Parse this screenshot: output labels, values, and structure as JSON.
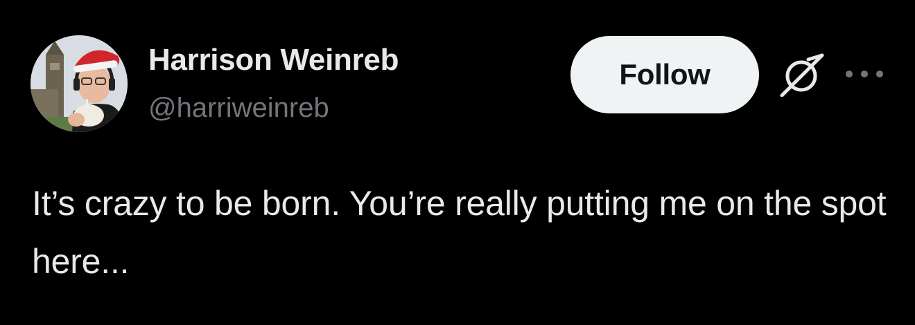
{
  "author": {
    "display_name": "Harrison Weinreb",
    "handle": "@harriweinreb",
    "avatar_icon": "profile-photo"
  },
  "actions": {
    "follow_label": "Follow",
    "grok_icon": "grok-icon",
    "more_icon": "more-icon"
  },
  "tweet": {
    "text": "It’s crazy to be born. You’re really putting me on the spot here..."
  },
  "colors": {
    "background": "#000000",
    "primary_text": "#e7e9ea",
    "secondary_text": "#71767b",
    "follow_bg": "#eff3f4",
    "follow_text": "#0f1419"
  }
}
